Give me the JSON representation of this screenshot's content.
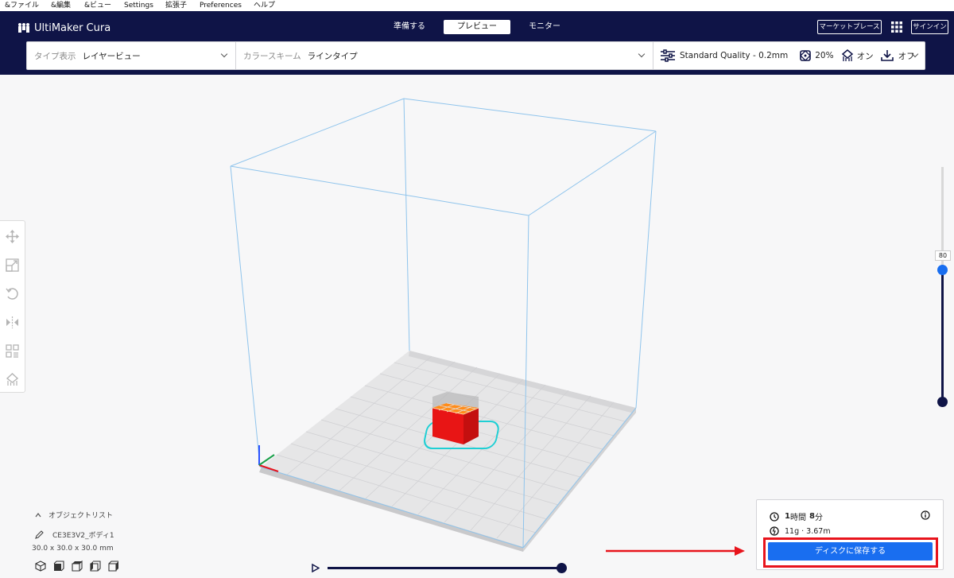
{
  "menu": [
    {
      "label": "&ファイル"
    },
    {
      "label": "&編集"
    },
    {
      "label": "&ビュー"
    },
    {
      "label": "Settings"
    },
    {
      "label": "拡張子"
    },
    {
      "label": "Preferences"
    },
    {
      "label": "ヘルプ"
    }
  ],
  "header": {
    "app_title": "UltiMaker Cura",
    "stages": [
      {
        "label": "準備する",
        "active": false
      },
      {
        "label": "プレビュー",
        "active": true
      },
      {
        "label": "モニター",
        "active": false
      }
    ],
    "marketplace_label": "マーケットプレース",
    "signin_label": "サインイン"
  },
  "toolbar": {
    "view_type_label": "タイプ表示",
    "view_type_value": "レイヤービュー",
    "color_scheme_label": "カラースキーム",
    "color_scheme_value": "ラインタイプ",
    "quality": "Standard Quality - 0.2mm",
    "infill": "20%",
    "support": "オン",
    "adhesion": "オフ"
  },
  "layer_slider": {
    "value": "80",
    "fraction": 0.46
  },
  "object_list": {
    "header": "オブジェクトリスト",
    "object_name": "CE3E3V2_ボディ1",
    "dimensions": "30.0 x 30.0 x 30.0 mm"
  },
  "playback": {
    "progress": 1.0
  },
  "print_info": {
    "hours": "1",
    "hours_unit": "時間",
    "minutes": "8",
    "minutes_unit": "分",
    "material": "11g · 3.67m",
    "save_label": "ディスクに保存する"
  },
  "colors": {
    "header_bg": "#0f1447",
    "accent": "#196ef0",
    "highlight": "#e8141c",
    "build_volume": "#8fc4ec",
    "model_wall": "#ff1a1a",
    "model_infill": "#ff8c1a",
    "skirt": "#1fcfd4"
  }
}
